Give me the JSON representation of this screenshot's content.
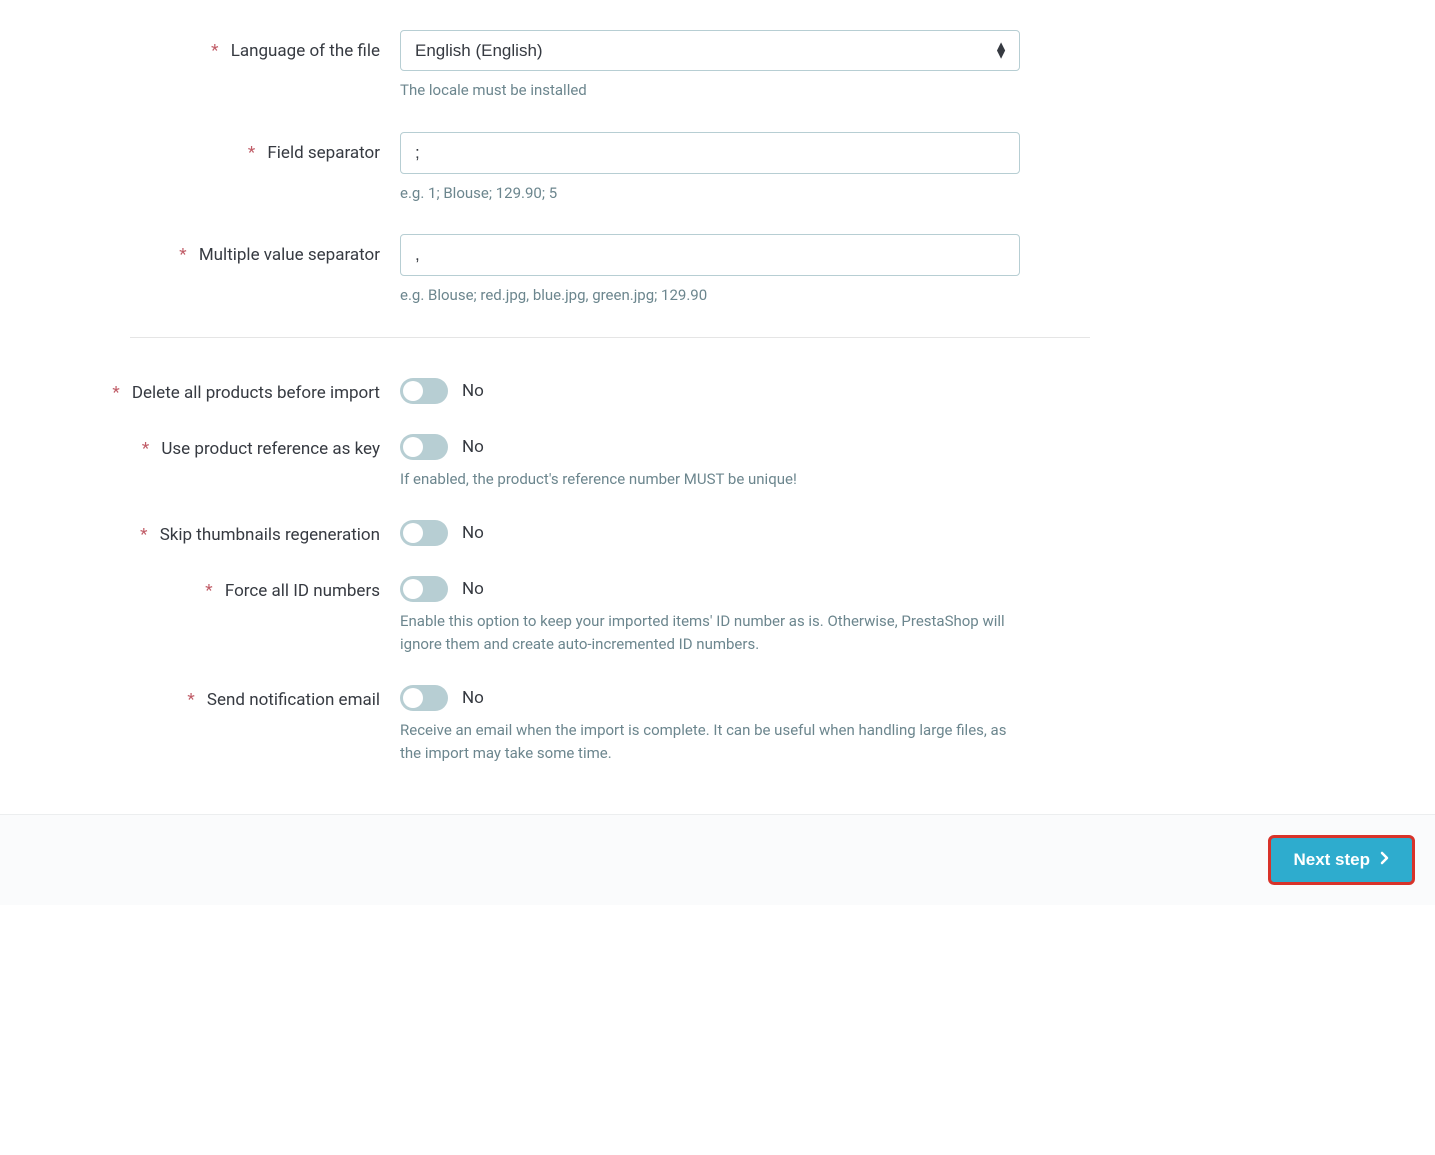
{
  "fields": {
    "language": {
      "label": "Language of the file",
      "value": "English (English)",
      "help": "The locale must be installed"
    },
    "field_separator": {
      "label": "Field separator",
      "value": ";",
      "help": "e.g. 1; Blouse; 129.90; 5"
    },
    "multiple_value_separator": {
      "label": "Multiple value separator",
      "value": ",",
      "help": "e.g. Blouse; red.jpg, blue.jpg, green.jpg; 129.90"
    },
    "delete_products": {
      "label": "Delete all products before import",
      "state": "No"
    },
    "use_reference": {
      "label": "Use product reference as key",
      "state": "No",
      "help": "If enabled, the product's reference number MUST be unique!"
    },
    "skip_thumbnails": {
      "label": "Skip thumbnails regeneration",
      "state": "No"
    },
    "force_id": {
      "label": "Force all ID numbers",
      "state": "No",
      "help": "Enable this option to keep your imported items' ID number as is. Otherwise, PrestaShop will ignore them and create auto-incremented ID numbers."
    },
    "send_email": {
      "label": "Send notification email",
      "state": "No",
      "help": "Receive an email when the import is complete. It can be useful when handling large files, as the import may take some time."
    }
  },
  "footer": {
    "next_button": "Next step"
  }
}
